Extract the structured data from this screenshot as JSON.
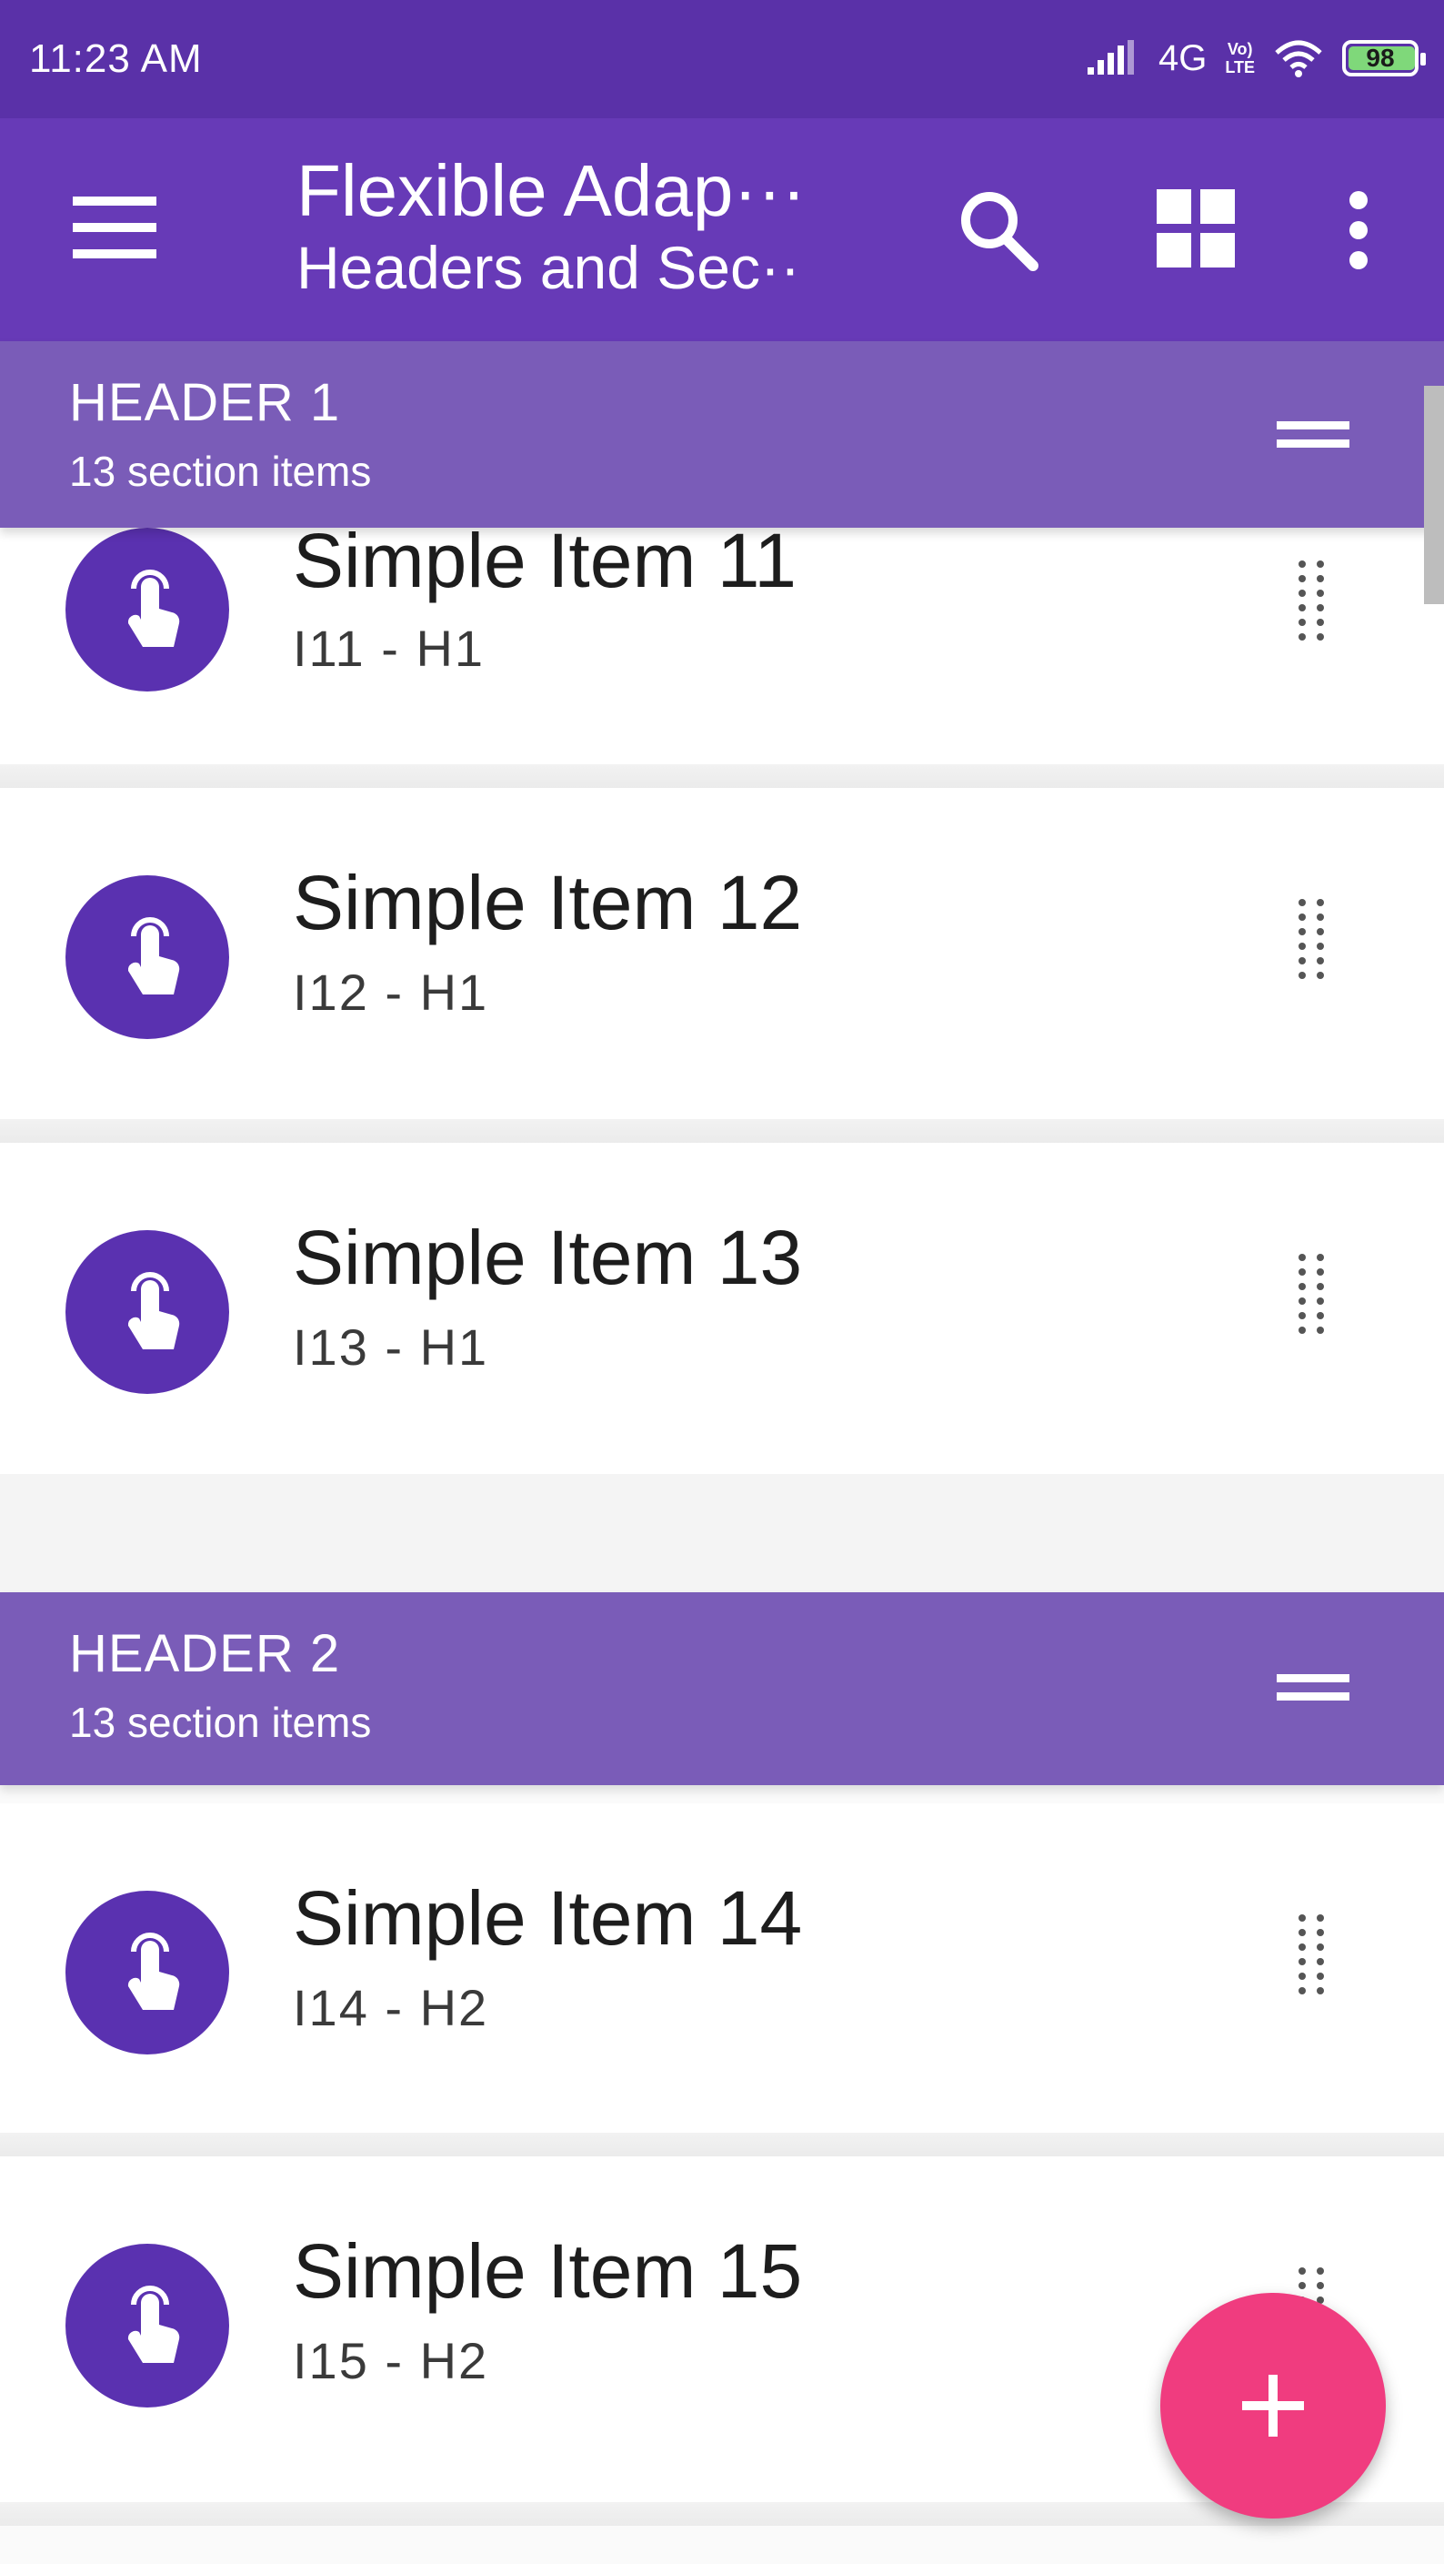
{
  "status_bar": {
    "time": "11:23 AM",
    "network": "4G",
    "volte_top": "Vo)",
    "volte_bottom": "LTE",
    "battery": "98"
  },
  "toolbar": {
    "title": "Flexible Adap···",
    "subtitle": "Headers and Sec··"
  },
  "headers": [
    {
      "title": "HEADER 1",
      "subtitle": "13 section items"
    },
    {
      "title": "HEADER 2",
      "subtitle": "13 section items"
    }
  ],
  "items": [
    {
      "title": "Simple Item 11",
      "subtitle": "I11 - H1"
    },
    {
      "title": "Simple Item 12",
      "subtitle": "I12 - H1"
    },
    {
      "title": "Simple Item 13",
      "subtitle": "I13 - H1"
    },
    {
      "title": "Simple Item 14",
      "subtitle": "I14 - H2"
    },
    {
      "title": "Simple Item 15",
      "subtitle": "I15 - H2"
    }
  ],
  "colors": {
    "status_bar": "#5a31a8",
    "toolbar": "#673ab7",
    "header": "#7a5cb8",
    "avatar": "#5a31b0",
    "fab": "#f03c7f"
  },
  "icons": {
    "menu": "menu-icon",
    "search": "search-icon",
    "view": "grid-view-icon",
    "more": "more-vert-icon",
    "header_action": "drag-handle-icon",
    "item_avatar": "touch-hand-icon",
    "item_action": "reorder-icon",
    "fab": "add-icon"
  }
}
